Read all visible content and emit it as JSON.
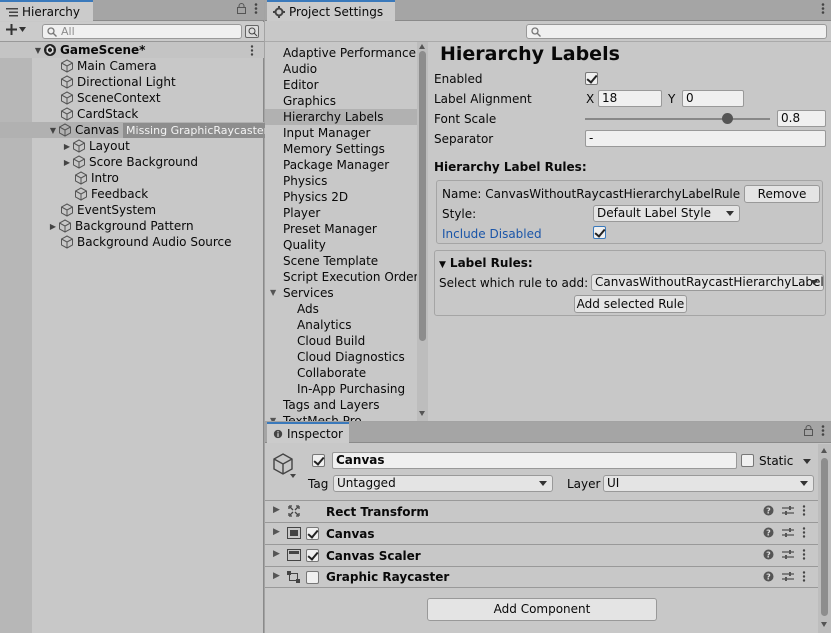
{
  "hierarchy": {
    "tab_title": "Hierarchy",
    "search_placeholder": "All",
    "scene_name": "GameScene*",
    "items": [
      {
        "label": "Main Camera"
      },
      {
        "label": "Directional Light"
      },
      {
        "label": "SceneContext"
      },
      {
        "label": "CardStack"
      },
      {
        "label": "Canvas",
        "badge": "Missing GraphicRaycaster!"
      },
      {
        "label": "Layout"
      },
      {
        "label": "Score Background"
      },
      {
        "label": "Intro"
      },
      {
        "label": "Feedback"
      },
      {
        "label": "EventSystem"
      },
      {
        "label": "Background Pattern"
      },
      {
        "label": "Background Audio Source"
      }
    ]
  },
  "project_settings": {
    "tab_title": "Project Settings",
    "categories": [
      "Adaptive Performance",
      "Audio",
      "Editor",
      "Graphics",
      "Hierarchy Labels",
      "Input Manager",
      "Memory Settings",
      "Package Manager",
      "Physics",
      "Physics 2D",
      "Player",
      "Preset Manager",
      "Quality",
      "Scene Template",
      "Script Execution Order",
      "Services",
      "Ads",
      "Analytics",
      "Cloud Build",
      "Cloud Diagnostics",
      "Collaborate",
      "In-App Purchasing",
      "Tags and Layers",
      "TextMesh Pro"
    ],
    "selected_category": "Hierarchy Labels",
    "page_title": "Hierarchy Labels",
    "enabled_label": "Enabled",
    "enabled_checked": true,
    "label_alignment_label": "Label Alignment",
    "x_label": "X",
    "x_value": "18",
    "y_label": "Y",
    "y_value": "0",
    "font_scale_label": "Font Scale",
    "font_scale_value": "0.8",
    "separator_label": "Separator",
    "separator_value": "-",
    "rules_header": "Hierarchy Label Rules:",
    "rule": {
      "name_text": "Name: CanvasWithoutRaycastHierarchyLabelRule",
      "remove_label": "Remove",
      "style_label": "Style:",
      "style_value": "Default Label Style",
      "include_disabled_label": "Include Disabled",
      "include_disabled_checked": true
    },
    "label_rules_header": "Label Rules:",
    "select_rule_label": "Select which rule to add:",
    "select_rule_value": "CanvasWithoutRaycastHierarchyLabelRule",
    "add_rule_label": "Add selected Rule"
  },
  "inspector": {
    "tab_title": "Inspector",
    "object_name": "Canvas",
    "active_checked": true,
    "static_label": "Static",
    "tag_label": "Tag",
    "tag_value": "Untagged",
    "layer_label": "Layer",
    "layer_value": "UI",
    "components": [
      {
        "name": "Rect Transform",
        "has_checkbox": false,
        "checked": false
      },
      {
        "name": "Canvas",
        "has_checkbox": true,
        "checked": true
      },
      {
        "name": "Canvas Scaler",
        "has_checkbox": true,
        "checked": true
      },
      {
        "name": "Graphic Raycaster",
        "has_checkbox": true,
        "checked": false
      }
    ],
    "add_component_label": "Add Component"
  },
  "colors": {
    "panel": "#c8c8c8",
    "selection": "#b1b1b1",
    "tab_accent": "#3a79bb",
    "link_blue": "#1a55a8"
  }
}
